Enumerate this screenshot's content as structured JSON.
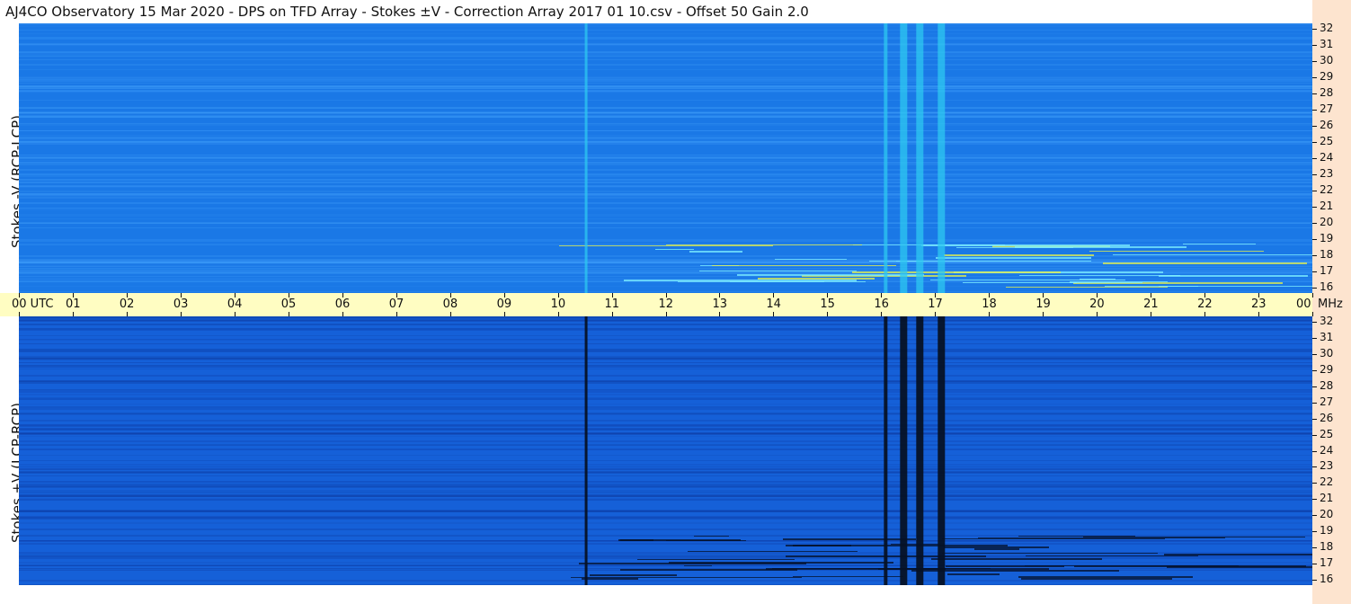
{
  "title": "AJ4CO Observatory  15 Mar 2020  -  DPS on TFD Array  -  Stokes ±V  -  Correction Array 2017 01 10.csv  -  Offset 50  Gain 2.0",
  "panels": {
    "top": {
      "label": "Stokes -V (RCP-LCP)",
      "base_color": "#1a78e6",
      "accent_color": "#2ec8f0"
    },
    "bottom": {
      "label": "Stokes +V (LCP-RCP)",
      "base_color": "#1560d8",
      "accent_color": "#061226"
    }
  },
  "time_axis": {
    "labels": [
      "00 UTC",
      "01",
      "02",
      "03",
      "04",
      "05",
      "06",
      "07",
      "08",
      "09",
      "10",
      "11",
      "12",
      "13",
      "14",
      "15",
      "16",
      "17",
      "18",
      "19",
      "20",
      "21",
      "22",
      "23",
      "00"
    ],
    "background": "#fffdc2"
  },
  "freq_axis": {
    "unit": "MHz",
    "labels": [
      "32",
      "31",
      "30",
      "29",
      "28",
      "27",
      "26",
      "25",
      "24",
      "23",
      "22",
      "21",
      "20",
      "19",
      "18",
      "17",
      "16"
    ],
    "background": "#fde4cf"
  },
  "interference_lines_utc": [
    10.5,
    16.05,
    16.35,
    16.65,
    17.05
  ]
}
